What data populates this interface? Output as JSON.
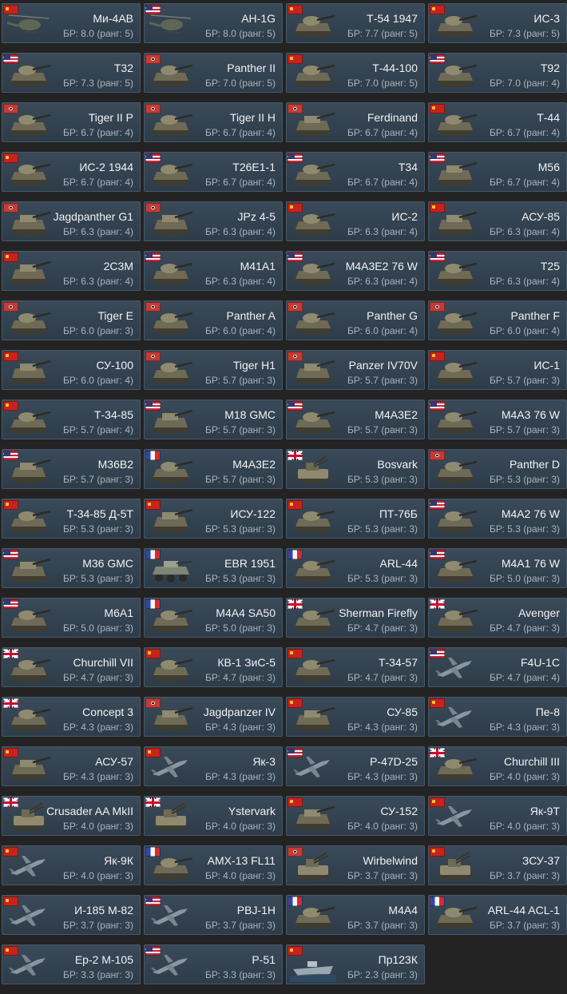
{
  "colors": {
    "background": "#232323",
    "card": "#33434f",
    "name_text": "#f2f2f2",
    "br_text": "#a9b5c0"
  },
  "vehicles": [
    {
      "name": "Ми-4АВ",
      "br": "БР: 8.0 (ранг: 5)",
      "nation": "ussr",
      "icon": "helicopter-icon"
    },
    {
      "name": "AH-1G",
      "br": "БР: 8.0 (ранг: 5)",
      "nation": "usa",
      "icon": "helicopter-icon"
    },
    {
      "name": "Т-54 1947",
      "br": "БР: 7.7 (ранг: 5)",
      "nation": "ussr",
      "icon": "tank-icon"
    },
    {
      "name": "ИС-3",
      "br": "БР: 7.3 (ранг: 5)",
      "nation": "ussr",
      "icon": "tank-icon"
    },
    {
      "name": "T32",
      "br": "БР: 7.3 (ранг: 5)",
      "nation": "usa",
      "icon": "tank-icon"
    },
    {
      "name": "Panther II",
      "br": "БР: 7.0 (ранг: 5)",
      "nation": "germany",
      "icon": "tank-icon"
    },
    {
      "name": "Т-44-100",
      "br": "БР: 7.0 (ранг: 5)",
      "nation": "ussr",
      "icon": "tank-icon"
    },
    {
      "name": "T92",
      "br": "БР: 7.0 (ранг: 4)",
      "nation": "usa",
      "icon": "tank-icon"
    },
    {
      "name": "Tiger II P",
      "br": "БР: 6.7 (ранг: 4)",
      "nation": "germany",
      "icon": "tank-icon"
    },
    {
      "name": "Tiger II H",
      "br": "БР: 6.7 (ранг: 4)",
      "nation": "germany",
      "icon": "tank-icon"
    },
    {
      "name": "Ferdinand",
      "br": "БР: 6.7 (ранг: 4)",
      "nation": "germany",
      "icon": "tank-destroyer-icon"
    },
    {
      "name": "Т-44",
      "br": "БР: 6.7 (ранг: 4)",
      "nation": "ussr",
      "icon": "tank-icon"
    },
    {
      "name": "ИС-2 1944",
      "br": "БР: 6.7 (ранг: 4)",
      "nation": "ussr",
      "icon": "tank-icon"
    },
    {
      "name": "T26E1-1",
      "br": "БР: 6.7 (ранг: 4)",
      "nation": "usa",
      "icon": "tank-icon"
    },
    {
      "name": "T34",
      "br": "БР: 6.7 (ранг: 4)",
      "nation": "usa",
      "icon": "tank-icon"
    },
    {
      "name": "M56",
      "br": "БР: 6.7 (ранг: 4)",
      "nation": "usa",
      "icon": "tank-destroyer-icon"
    },
    {
      "name": "Jagdpanther G1",
      "br": "БР: 6.3 (ранг: 4)",
      "nation": "germany",
      "icon": "tank-destroyer-icon"
    },
    {
      "name": "JPz 4-5",
      "br": "БР: 6.3 (ранг: 4)",
      "nation": "germany",
      "icon": "tank-destroyer-icon"
    },
    {
      "name": "ИС-2",
      "br": "БР: 6.3 (ранг: 4)",
      "nation": "ussr",
      "icon": "tank-icon"
    },
    {
      "name": "АСУ-85",
      "br": "БР: 6.3 (ранг: 4)",
      "nation": "ussr",
      "icon": "tank-destroyer-icon"
    },
    {
      "name": "2С3М",
      "br": "БР: 6.3 (ранг: 4)",
      "nation": "ussr",
      "icon": "artillery-icon"
    },
    {
      "name": "M41A1",
      "br": "БР: 6.3 (ранг: 4)",
      "nation": "usa",
      "icon": "tank-icon"
    },
    {
      "name": "M4A3E2 76 W",
      "br": "БР: 6.3 (ранг: 4)",
      "nation": "usa",
      "icon": "tank-icon"
    },
    {
      "name": "T25",
      "br": "БР: 6.3 (ранг: 4)",
      "nation": "usa",
      "icon": "tank-icon"
    },
    {
      "name": "Tiger E",
      "br": "БР: 6.0 (ранг: 3)",
      "nation": "germany",
      "icon": "tank-icon"
    },
    {
      "name": "Panther A",
      "br": "БР: 6.0 (ранг: 4)",
      "nation": "germany",
      "icon": "tank-icon"
    },
    {
      "name": "Panther G",
      "br": "БР: 6.0 (ранг: 4)",
      "nation": "germany",
      "icon": "tank-icon"
    },
    {
      "name": "Panther F",
      "br": "БР: 6.0 (ранг: 4)",
      "nation": "germany",
      "icon": "tank-icon"
    },
    {
      "name": "СУ-100",
      "br": "БР: 6.0 (ранг: 4)",
      "nation": "ussr",
      "icon": "tank-destroyer-icon"
    },
    {
      "name": "Tiger H1",
      "br": "БР: 5.7 (ранг: 3)",
      "nation": "germany",
      "icon": "tank-icon"
    },
    {
      "name": "Panzer IV70V",
      "br": "БР: 5.7 (ранг: 3)",
      "nation": "germany",
      "icon": "tank-destroyer-icon"
    },
    {
      "name": "ИС-1",
      "br": "БР: 5.7 (ранг: 3)",
      "nation": "ussr",
      "icon": "tank-icon"
    },
    {
      "name": "Т-34-85",
      "br": "БР: 5.7 (ранг: 4)",
      "nation": "ussr",
      "icon": "tank-icon"
    },
    {
      "name": "M18 GMC",
      "br": "БР: 5.7 (ранг: 3)",
      "nation": "usa",
      "icon": "tank-destroyer-icon"
    },
    {
      "name": "M4A3E2",
      "br": "БР: 5.7 (ранг: 3)",
      "nation": "usa",
      "icon": "tank-icon"
    },
    {
      "name": "M4A3 76 W",
      "br": "БР: 5.7 (ранг: 3)",
      "nation": "usa",
      "icon": "tank-icon"
    },
    {
      "name": "M36B2",
      "br": "БР: 5.7 (ранг: 3)",
      "nation": "usa",
      "icon": "tank-destroyer-icon"
    },
    {
      "name": "M4A3E2",
      "br": "БР: 5.7 (ранг: 3)",
      "nation": "france",
      "icon": "tank-icon"
    },
    {
      "name": "Bosvark",
      "br": "БР: 5.3 (ранг: 3)",
      "nation": "uk",
      "icon": "spaa-icon"
    },
    {
      "name": "Panther D",
      "br": "БР: 5.3 (ранг: 3)",
      "nation": "germany",
      "icon": "tank-icon"
    },
    {
      "name": "Т-34-85 Д-5Т",
      "br": "БР: 5.3 (ранг: 3)",
      "nation": "ussr",
      "icon": "tank-icon"
    },
    {
      "name": "ИСУ-122",
      "br": "БР: 5.3 (ранг: 3)",
      "nation": "ussr",
      "icon": "tank-destroyer-icon"
    },
    {
      "name": "ПТ-76Б",
      "br": "БР: 5.3 (ранг: 3)",
      "nation": "ussr",
      "icon": "tank-icon"
    },
    {
      "name": "M4A2 76 W",
      "br": "БР: 5.3 (ранг: 3)",
      "nation": "usa",
      "icon": "tank-icon"
    },
    {
      "name": "M36 GMC",
      "br": "БР: 5.3 (ранг: 3)",
      "nation": "usa",
      "icon": "tank-destroyer-icon"
    },
    {
      "name": "EBR 1951",
      "br": "БР: 5.3 (ранг: 3)",
      "nation": "france",
      "icon": "armored-car-icon"
    },
    {
      "name": "ARL-44",
      "br": "БР: 5.3 (ранг: 3)",
      "nation": "france",
      "icon": "tank-icon"
    },
    {
      "name": "M4A1 76 W",
      "br": "БР: 5.0 (ранг: 3)",
      "nation": "usa",
      "icon": "tank-icon"
    },
    {
      "name": "M6A1",
      "br": "БР: 5.0 (ранг: 3)",
      "nation": "usa",
      "icon": "tank-icon"
    },
    {
      "name": "M4A4 SA50",
      "br": "БР: 5.0 (ранг: 3)",
      "nation": "france",
      "icon": "tank-icon"
    },
    {
      "name": "Sherman Firefly",
      "br": "БР: 4.7 (ранг: 3)",
      "nation": "uk",
      "icon": "tank-icon"
    },
    {
      "name": "Avenger",
      "br": "БР: 4.7 (ранг: 3)",
      "nation": "uk",
      "icon": "tank-icon"
    },
    {
      "name": "Churchill VII",
      "br": "БР: 4.7 (ранг: 3)",
      "nation": "uk",
      "icon": "tank-icon"
    },
    {
      "name": "КВ-1 ЗиС-5",
      "br": "БР: 4.7 (ранг: 3)",
      "nation": "ussr",
      "icon": "tank-icon"
    },
    {
      "name": "Т-34-57",
      "br": "БР: 4.7 (ранг: 3)",
      "nation": "ussr",
      "icon": "tank-icon"
    },
    {
      "name": "F4U-1C",
      "br": "БР: 4.7 (ранг: 4)",
      "nation": "usa",
      "icon": "plane-icon"
    },
    {
      "name": "Concept 3",
      "br": "БР: 4.3 (ранг: 3)",
      "nation": "uk",
      "icon": "tank-icon"
    },
    {
      "name": "Jagdpanzer IV",
      "br": "БР: 4.3 (ранг: 3)",
      "nation": "germany",
      "icon": "tank-destroyer-icon"
    },
    {
      "name": "СУ-85",
      "br": "БР: 4.3 (ранг: 3)",
      "nation": "ussr",
      "icon": "tank-destroyer-icon"
    },
    {
      "name": "Пе-8",
      "br": "БР: 4.3 (ранг: 3)",
      "nation": "ussr",
      "icon": "plane-icon"
    },
    {
      "name": "АСУ-57",
      "br": "БР: 4.3 (ранг: 3)",
      "nation": "ussr",
      "icon": "tank-destroyer-icon"
    },
    {
      "name": "Як-3",
      "br": "БР: 4.3 (ранг: 3)",
      "nation": "ussr",
      "icon": "plane-icon"
    },
    {
      "name": "P-47D-25",
      "br": "БР: 4.3 (ранг: 3)",
      "nation": "usa",
      "icon": "plane-icon"
    },
    {
      "name": "Churchill III",
      "br": "БР: 4.0 (ранг: 3)",
      "nation": "uk",
      "icon": "tank-icon"
    },
    {
      "name": "Crusader AA MkII",
      "br": "БР: 4.0 (ранг: 3)",
      "nation": "uk",
      "icon": "spaa-icon"
    },
    {
      "name": "Ystervark",
      "br": "БР: 4.0 (ранг: 3)",
      "nation": "uk",
      "icon": "spaa-icon"
    },
    {
      "name": "СУ-152",
      "br": "БР: 4.0 (ранг: 3)",
      "nation": "ussr",
      "icon": "tank-destroyer-icon"
    },
    {
      "name": "Як-9Т",
      "br": "БР: 4.0 (ранг: 3)",
      "nation": "ussr",
      "icon": "plane-icon"
    },
    {
      "name": "Як-9К",
      "br": "БР: 4.0 (ранг: 3)",
      "nation": "ussr",
      "icon": "plane-icon"
    },
    {
      "name": "AMX-13 FL11",
      "br": "БР: 4.0 (ранг: 3)",
      "nation": "france",
      "icon": "tank-icon"
    },
    {
      "name": "Wirbelwind",
      "br": "БР: 3.7 (ранг: 3)",
      "nation": "germany",
      "icon": "spaa-icon"
    },
    {
      "name": "ЗСУ-37",
      "br": "БР: 3.7 (ранг: 3)",
      "nation": "ussr",
      "icon": "spaa-icon"
    },
    {
      "name": "И-185 М-82",
      "br": "БР: 3.7 (ранг: 3)",
      "nation": "ussr",
      "icon": "plane-icon"
    },
    {
      "name": "PBJ-1H",
      "br": "БР: 3.7 (ранг: 3)",
      "nation": "usa",
      "icon": "plane-icon"
    },
    {
      "name": "M4A4",
      "br": "БР: 3.7 (ранг: 3)",
      "nation": "france",
      "icon": "tank-icon"
    },
    {
      "name": "ARL-44 ACL-1",
      "br": "БР: 3.7 (ранг: 3)",
      "nation": "france",
      "icon": "tank-icon"
    },
    {
      "name": "Ер-2 М-105",
      "br": "БР: 3.3 (ранг: 3)",
      "nation": "ussr",
      "icon": "plane-icon"
    },
    {
      "name": "P-51",
      "br": "БР: 3.3 (ранг: 3)",
      "nation": "usa",
      "icon": "plane-icon"
    },
    {
      "name": "Пр123К",
      "br": "БР: 2.3 (ранг: 3)",
      "nation": "ussr",
      "icon": "boat-icon"
    }
  ]
}
